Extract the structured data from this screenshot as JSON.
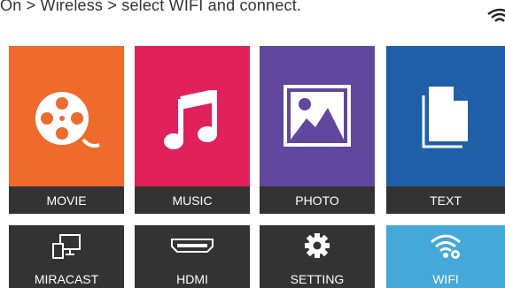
{
  "header": {
    "instruction": "On > Wireless > select WIFI and connect.",
    "status_icon": "wifi-icon"
  },
  "tiles": [
    {
      "label": "MOVIE",
      "icon": "film-reel-icon",
      "color": "#ee6b2b"
    },
    {
      "label": "MUSIC",
      "icon": "music-note-icon",
      "color": "#e2205a"
    },
    {
      "label": "PHOTO",
      "icon": "photo-icon",
      "color": "#61469e"
    },
    {
      "label": "TEXT",
      "icon": "document-icon",
      "color": "#1f5fa8"
    },
    {
      "label": "MIRACAST",
      "icon": "screen-mirror-icon",
      "color": "#333333"
    },
    {
      "label": "HDMI",
      "icon": "hdmi-icon",
      "color": "#333333"
    },
    {
      "label": "SETTING",
      "icon": "gear-icon",
      "color": "#333333"
    },
    {
      "label": "WIFI",
      "icon": "wifi-settings-icon",
      "color": "#44a8d8"
    }
  ]
}
